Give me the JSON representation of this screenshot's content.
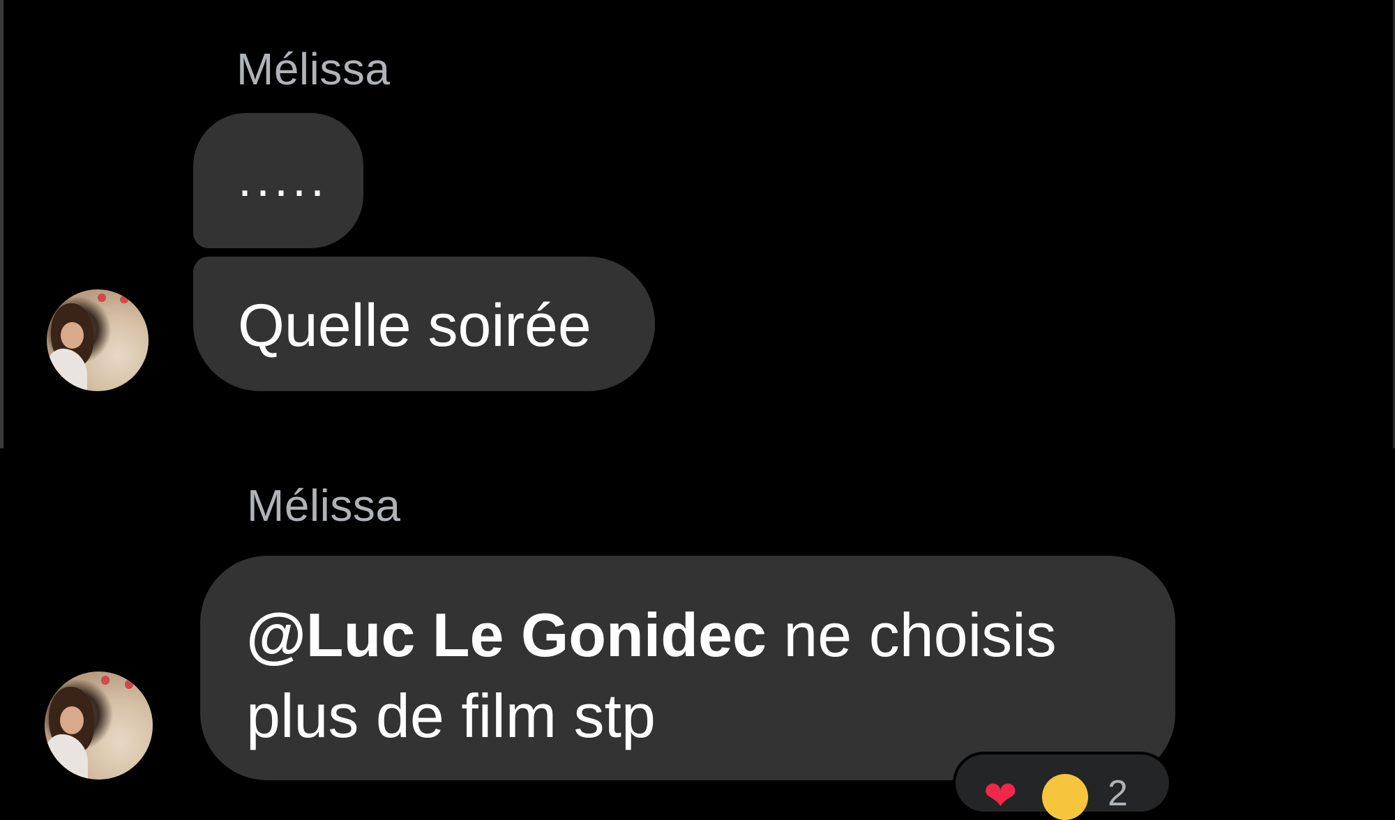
{
  "theme": {
    "background": "#000000",
    "bubble": "#333333",
    "sender_color": "#b0b3b8",
    "text_color": "#ffffff",
    "heart_color": "#f02849",
    "laugh_color": "#f7c53c"
  },
  "top_conversation": {
    "sender_name": "Mélissa",
    "messages": [
      {
        "text": "....."
      },
      {
        "text": "Quelle soirée"
      }
    ],
    "avatar_icon": "user-photo-avatar"
  },
  "bottom_conversation": {
    "sender_name": "Mélissa",
    "message": {
      "mention": "@Luc Le Gonidec",
      "text_line1": " ne choisis",
      "text_line2": "plus de film stp"
    },
    "avatar_icon": "user-photo-avatar",
    "reactions": {
      "heart_icon": "❤",
      "laugh_icon": "laughing-tears-icon",
      "count": "2"
    }
  }
}
